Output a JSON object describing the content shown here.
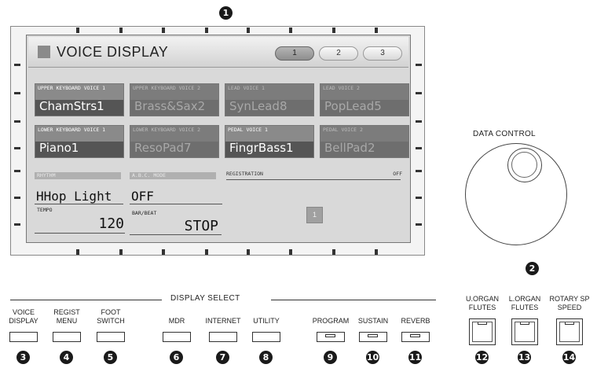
{
  "screen": {
    "title": "VOICE DISPLAY",
    "pages": [
      "1",
      "2",
      "3"
    ],
    "active_page": "1",
    "voices": [
      {
        "header": "UPPER KEYBOARD VOICE 1",
        "name": "ChamStrs1",
        "active": true
      },
      {
        "header": "UPPER KEYBOARD VOICE 2",
        "name": "Brass&Sax2",
        "active": false
      },
      {
        "header": "LEAD VOICE 1",
        "name": "SynLead8",
        "active": false
      },
      {
        "header": "LEAD VOICE 2",
        "name": "PopLead5",
        "active": false
      },
      {
        "header": "LOWER KEYBOARD VOICE 1",
        "name": "Piano1",
        "active": true
      },
      {
        "header": "LOWER KEYBOARD VOICE 2",
        "name": "ResoPad7",
        "active": false
      },
      {
        "header": "PEDAL VOICE 1",
        "name": "FingrBass1",
        "active": true
      },
      {
        "header": "PEDAL VOICE 2",
        "name": "BellPad2",
        "active": false
      }
    ],
    "rhythm": {
      "label": "RHYTHM",
      "value": "HHop Light"
    },
    "abc_mode": {
      "label": "A.B.C. MODE",
      "value": "OFF"
    },
    "tempo": {
      "label": "TEMPO",
      "value": "120"
    },
    "bar_beat": {
      "label": "BAR/BEAT",
      "value": "STOP"
    },
    "registration": {
      "label": "REGISTRATION",
      "value": "OFF",
      "page": "1"
    }
  },
  "data_control": {
    "label": "DATA CONTROL"
  },
  "display_select": {
    "label": "DISPLAY SELECT"
  },
  "buttons": [
    {
      "label": "VOICE\nDISPLAY",
      "num": "3"
    },
    {
      "label": "REGIST\nMENU",
      "num": "4"
    },
    {
      "label": "FOOT\nSWITCH",
      "num": "5"
    },
    {
      "label": "MDR",
      "num": "6"
    },
    {
      "label": "INTERNET",
      "num": "7"
    },
    {
      "label": "UTILITY",
      "num": "8"
    },
    {
      "label": "PROGRAM",
      "num": "9"
    },
    {
      "label": "SUSTAIN",
      "num": "10"
    },
    {
      "label": "REVERB",
      "num": "11"
    },
    {
      "label": "U.ORGAN\nFLUTES",
      "num": "12"
    },
    {
      "label": "L.ORGAN\nFLUTES",
      "num": "13"
    },
    {
      "label": "ROTARY SP\nSPEED",
      "num": "14"
    }
  ],
  "callouts": {
    "display": "1",
    "data_control": "2"
  }
}
